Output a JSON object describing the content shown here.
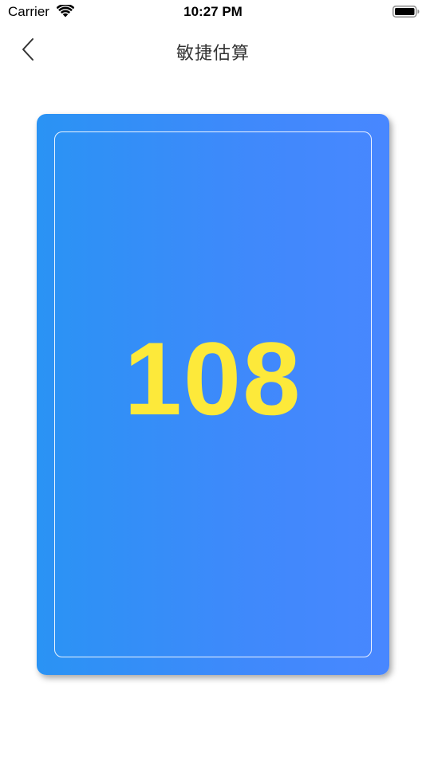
{
  "status_bar": {
    "carrier": "Carrier",
    "time": "10:27 PM",
    "wifi_icon": "wifi-icon",
    "battery_icon": "battery-full-icon"
  },
  "nav": {
    "back_icon": "chevron-left-icon",
    "title": "敏捷估算"
  },
  "card": {
    "value": "108",
    "number_color": "#fde93a",
    "gradient_start": "#2a93f4",
    "gradient_end": "#4887ff"
  }
}
